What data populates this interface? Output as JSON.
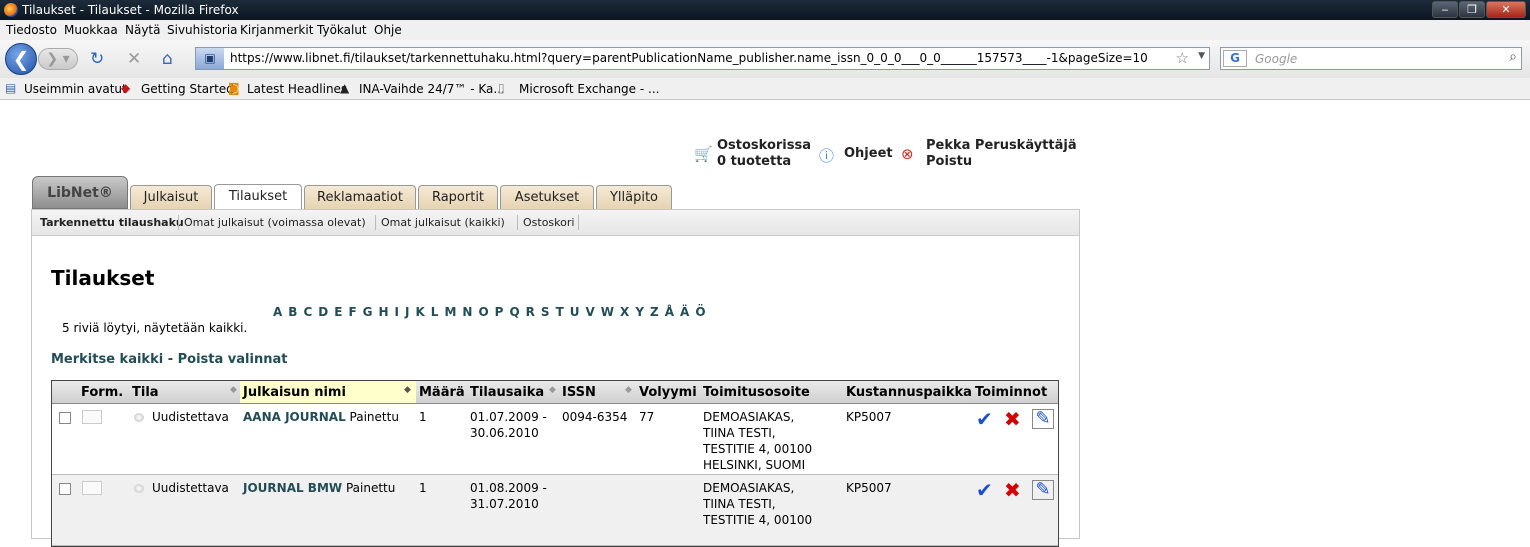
{
  "window": {
    "title": "Tilaukset - Tilaukset - Mozilla Firefox"
  },
  "menu": [
    "Tiedosto",
    "Muokkaa",
    "Näytä",
    "Sivuhistoria",
    "Kirjanmerkit",
    "Työkalut",
    "Ohje"
  ],
  "nav": {
    "url": "https://www.libnet.fi/tilaukset/tarkennettuhaku.html?query=parentPublicationName_publisher.name_issn_0_0_0___0_0______157573____-1&pageSize=10",
    "search_placeholder": "Google"
  },
  "bookmarks": [
    "Useimmin avatut",
    "Getting Started",
    "Latest Headlines",
    "INA-Vaihde 24/7™ - Ka...",
    "Microsoft Exchange - ..."
  ],
  "userbar": {
    "cart_line1": "Ostoskorissa",
    "cart_line2": "0 tuotetta",
    "help": "Ohjeet",
    "user_line1": "Pekka Peruskäyttäjä",
    "user_line2": "Poistu"
  },
  "logo": "LibNet®",
  "tabs": [
    "Julkaisut",
    "Tilaukset",
    "Reklamaatiot",
    "Raportit",
    "Asetukset",
    "Ylläpito"
  ],
  "subnav": [
    "Tarkennettu tilaushaku",
    "Omat julkaisut (voimassa olevat)",
    "Omat julkaisut (kaikki)",
    "Ostoskori"
  ],
  "page": {
    "title": "Tilaukset",
    "alphabet": [
      "A",
      "B",
      "C",
      "D",
      "E",
      "F",
      "G",
      "H",
      "I",
      "J",
      "K",
      "L",
      "M",
      "N",
      "O",
      "P",
      "Q",
      "R",
      "S",
      "T",
      "U",
      "V",
      "W",
      "X",
      "Y",
      "Z",
      "Å",
      "Ä",
      "Ö"
    ],
    "results_info": "5 riviä löytyi, näytetään kaikki.",
    "select_all": "Merkitse kaikki",
    "clear": "Poista valinnat"
  },
  "grid": {
    "headers": {
      "form": "Form.",
      "state": "Tila",
      "name": "Julkaisun nimi",
      "qty": "Määrä",
      "date": "Tilausaika",
      "issn": "ISSN",
      "vol": "Volyymi",
      "addr": "Toimitusosoite",
      "cost": "Kustannuspaikka",
      "actions": "Toiminnot"
    },
    "rows": [
      {
        "state": "Uudistettava",
        "name": "AANA JOURNAL",
        "format": "Painettu",
        "qty": "1",
        "date1": "01.07.2009 -",
        "date2": "30.06.2010",
        "issn": "0094-6354",
        "vol": "77",
        "addr1": "DEMOASIAKAS,",
        "addr2": "TIINA TESTI,",
        "addr3": "TESTITIE 4, 00100",
        "addr4": "HELSINKI, SUOMI",
        "cost": "KP5007"
      },
      {
        "state": "Uudistettava",
        "name": "JOURNAL BMW",
        "format": "Painettu",
        "qty": "1",
        "date1": "01.08.2009 -",
        "date2": "31.07.2010",
        "issn": "",
        "vol": "",
        "addr1": "DEMOASIAKAS,",
        "addr2": "TIINA TESTI,",
        "addr3": "TESTITIE 4, 00100",
        "addr4": "",
        "cost": "KP5007"
      }
    ]
  },
  "colors": {
    "link": "#234d55",
    "tab_bg": "#e4d2b0",
    "accept": "#1a4fd0",
    "reject": "#d40000"
  }
}
